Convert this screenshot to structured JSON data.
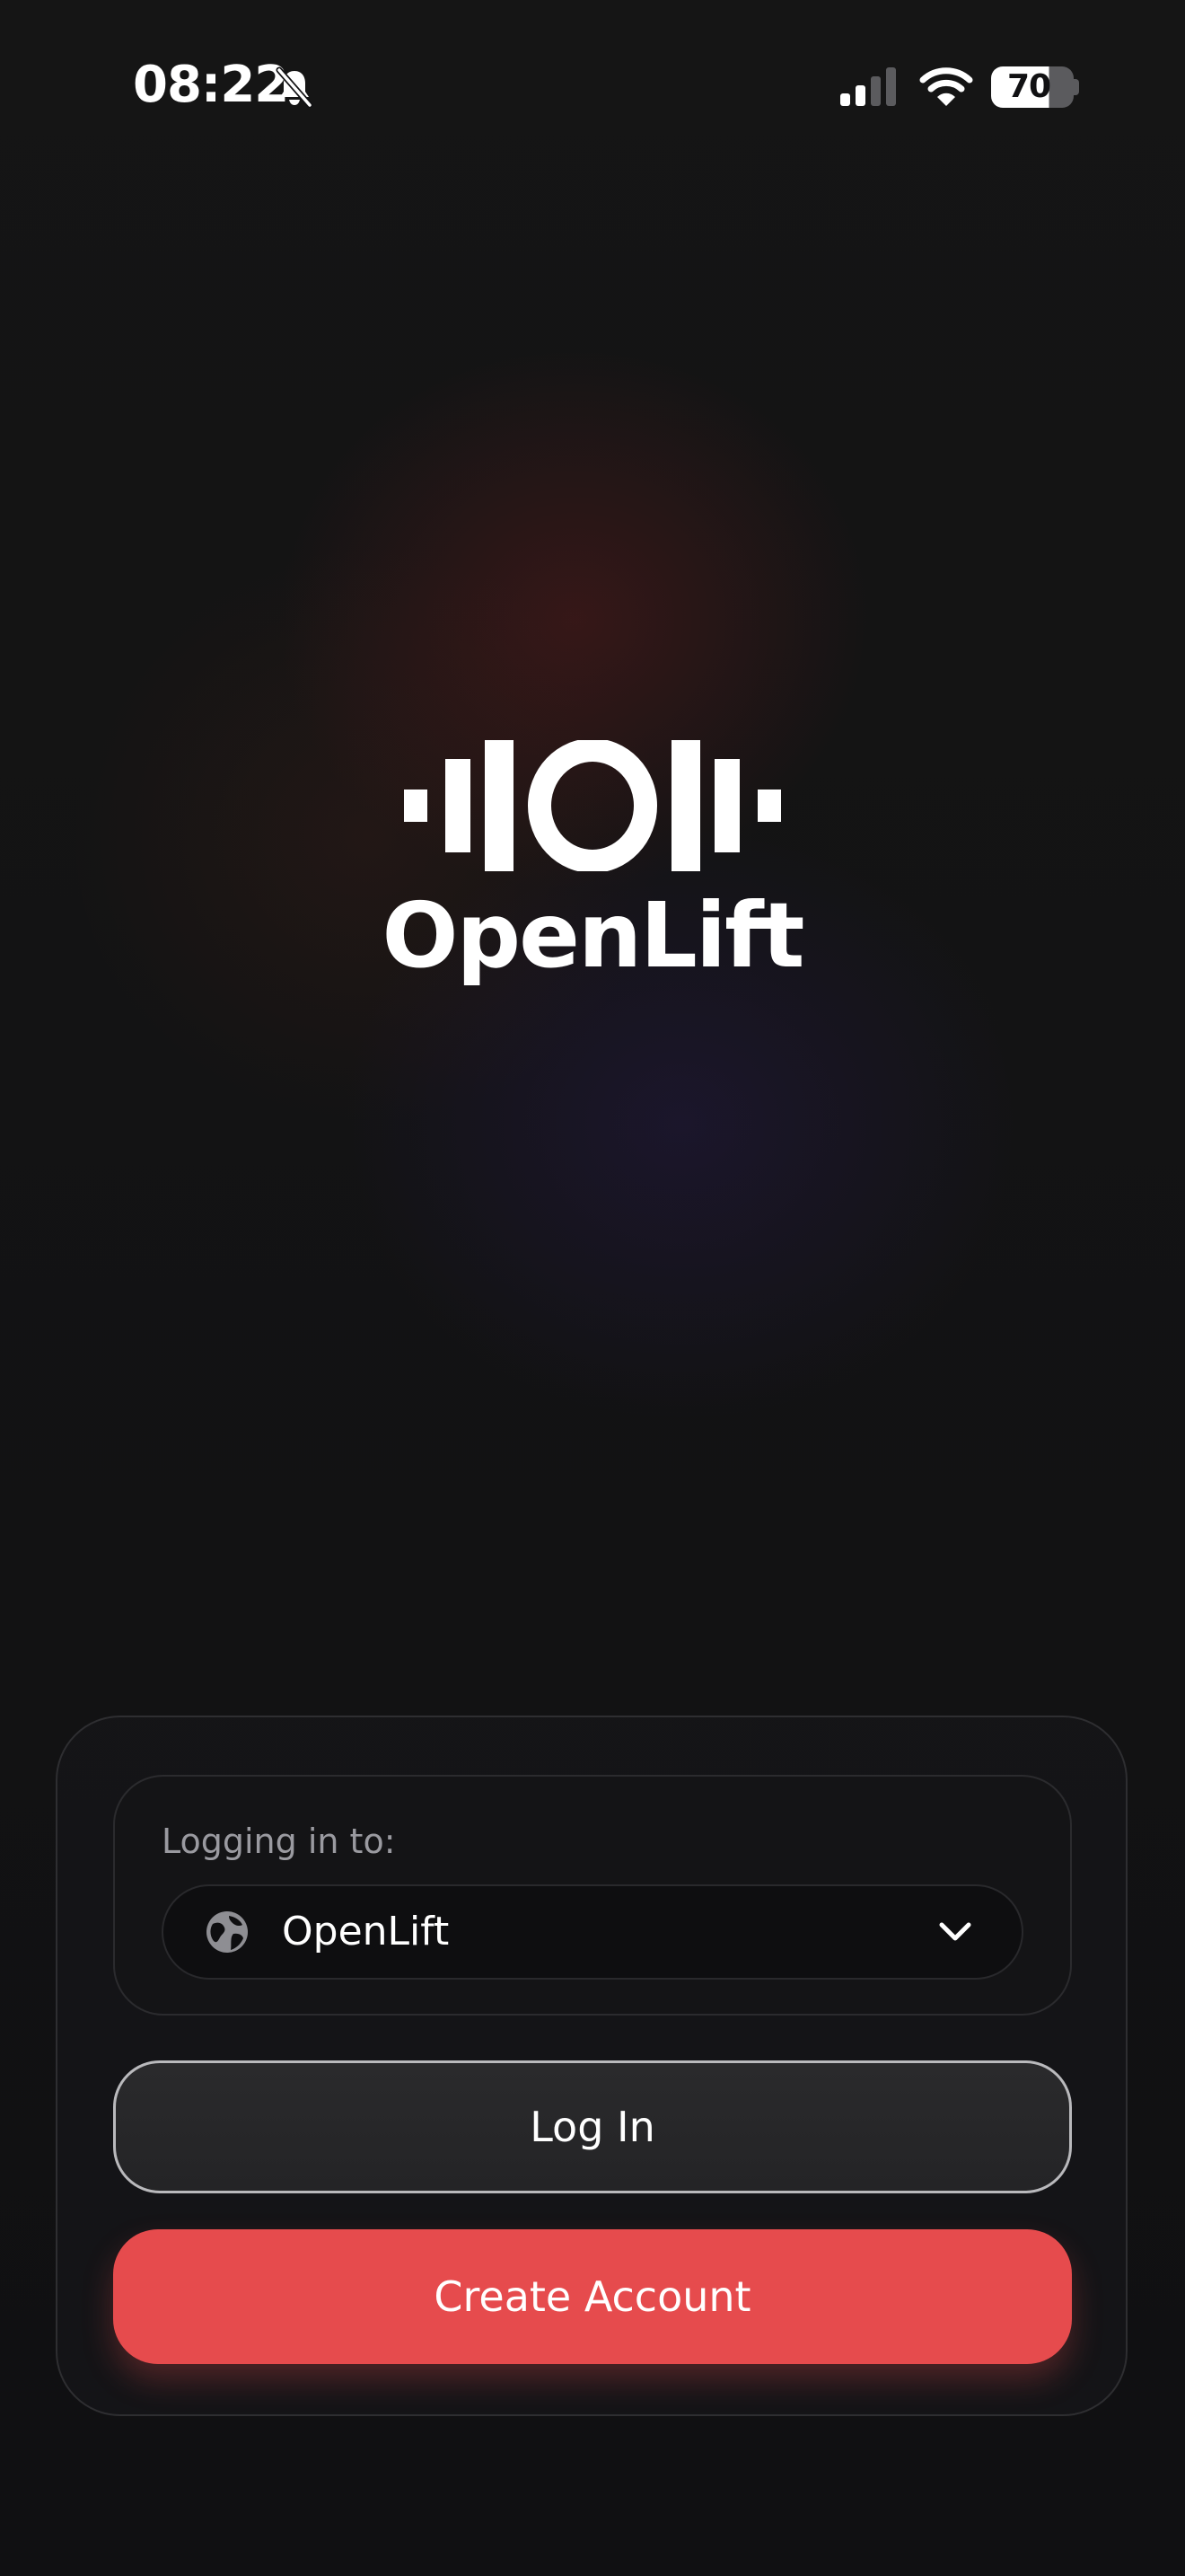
{
  "status_bar": {
    "time": "08:22",
    "battery_percent": "70",
    "icons": [
      "bell-slash-icon",
      "signal-icon",
      "wifi-icon",
      "battery-icon"
    ]
  },
  "app": {
    "name": "OpenLift",
    "logo_icon": "barbell-logo-icon"
  },
  "login_card": {
    "server_label": "Logging in to:",
    "server_value": "OpenLift",
    "server_icon": "globe-icon",
    "dropdown_icon": "chevron-down-icon",
    "login_label": "Log In",
    "create_account_label": "Create Account"
  },
  "colors": {
    "background": "#111113",
    "accent": "#e64b4d",
    "muted_text": "#9a9aa0"
  }
}
